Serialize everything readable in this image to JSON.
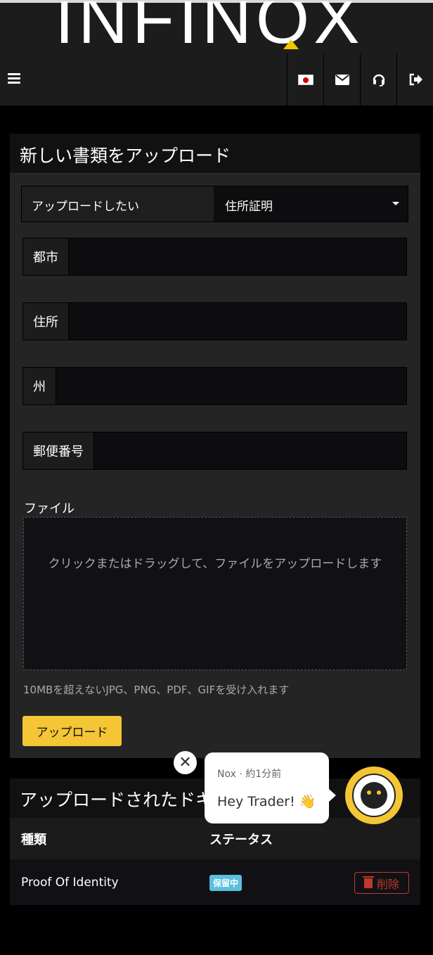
{
  "header": {
    "logo_text": "INFINOX",
    "language_flag": "flag-japan-icon",
    "icons": [
      "flag-icon",
      "envelope-icon",
      "headset-icon",
      "logout-icon"
    ]
  },
  "upload_form": {
    "title": "新しい書類をアップロード",
    "type_label": "アップロードしたい",
    "type_value": "住所証明",
    "fields": {
      "city": "都市",
      "address": "住所",
      "state": "州",
      "postal_code": "郵便番号"
    },
    "file_label": "ファイル",
    "dropzone_text": "クリックまたはドラッグして、ファイルをアップロードします",
    "hint": "10MBを超えないJPG、PNG、PDF、GIFを受け入れます",
    "submit_label": "アップロード"
  },
  "uploaded": {
    "title": "アップロードされたドキュメント",
    "columns": {
      "type": "種類",
      "status": "ステータス"
    },
    "rows": [
      {
        "type": "Proof Of Identity",
        "status": "保留中",
        "action": "削除"
      }
    ]
  },
  "chat": {
    "close": "✕",
    "meta": "Nox · 約1分前",
    "message": "Hey Trader! 👋"
  },
  "colors": {
    "accent": "#f4c534",
    "danger": "#c0392b",
    "badge": "#5bc0de"
  }
}
